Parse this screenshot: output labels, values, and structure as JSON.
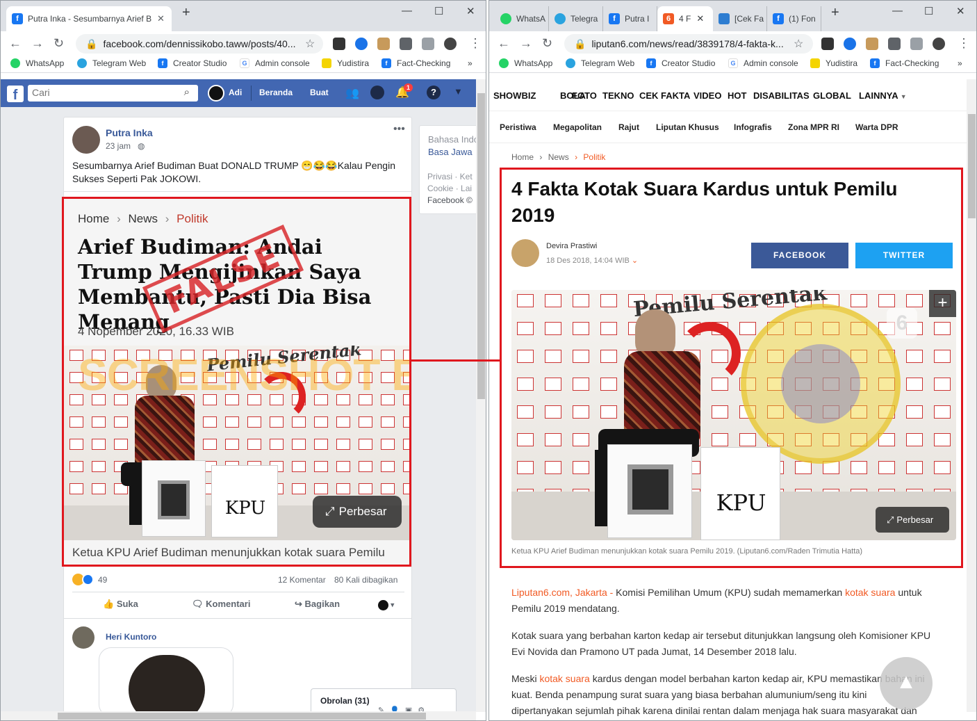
{
  "left": {
    "tab_title": "Putra Inka - Sesumbarnya Arief B",
    "url": "facebook.com/dennissikobo.taww/posts/40...",
    "bookmarks": [
      "WhatsApp",
      "Telegram Web",
      "Creator Studio",
      "Admin console",
      "Yudistira",
      "Fact-Checking"
    ],
    "fb": {
      "search_placeholder": "Cari",
      "user": "Adi",
      "nav": [
        "Beranda",
        "Buat"
      ],
      "notif_count": "1",
      "post": {
        "author": "Putra Inka",
        "time": "23 jam",
        "text_line1": "Sesumbarnya Arief Budiman Buat DONALD TRUMP 😁😂😂Kalau Pengin",
        "text_line2": "Sukses Seperti Pak JOKOWI.",
        "shared_article": {
          "breadcrumb": [
            "Home",
            "News",
            "Politik"
          ],
          "title": "Arief Budiman: Andai Trump Mengijinkan Saya Membantu, Pasti Dia Bisa Menang",
          "date": "4 Nopember 2020, 16.33 WIB",
          "stamp": "FALSE",
          "watermark": "SCREENSHOT BY",
          "enlarge": "Perbesar",
          "caption": "Ketua KPU Arief Budiman menunjukkan kotak suara Pemilu"
        },
        "reaction_count": "49",
        "comments": "12 Komentar",
        "shares": "80 Kali dibagikan",
        "actions": [
          "Suka",
          "Komentari",
          "Bagikan"
        ],
        "commenter": "Heri Kuntoro"
      },
      "side": {
        "lang1": "Bahasa Indo",
        "lang2": "Basa Jawa",
        "foot1": "Privasi · Ket",
        "foot2": "Cookie · Lai",
        "foot3": "Facebook ©"
      },
      "chat": "Obrolan (31)"
    }
  },
  "right": {
    "tabs": [
      "WhatsA",
      "Telegra",
      "Putra I",
      "4 F",
      "[Cek Fa",
      "(1) Fon"
    ],
    "url": "liputan6.com/news/read/3839178/4-fakta-k...",
    "bookmarks": [
      "WhatsApp",
      "Telegram Web",
      "Creator Studio",
      "Admin console",
      "Yudistira",
      "Fact-Checking"
    ],
    "nav1": [
      "SHOWBIZ",
      "BOLA",
      "FOTO",
      "TEKNO",
      "CEK FAKTA",
      "VIDEO",
      "HOT",
      "DISABILITAS",
      "GLOBAL",
      "LAINNYA"
    ],
    "nav2": [
      "Peristiwa",
      "Megapolitan",
      "Rajut",
      "Liputan Khusus",
      "Infografis",
      "Zona MPR RI",
      "Warta DPR"
    ],
    "breadcrumb": [
      "Home",
      "News",
      "Politik"
    ],
    "title_line1": "4 Fakta Kotak Suara Kardus untuk Pemilu",
    "title_line2": "2019",
    "author": "Devira Prastiwi",
    "date": "18 Des 2018, 14:04 WIB",
    "share_fb": "FACEBOOK",
    "share_tw": "TWITTER",
    "enlarge": "Perbesar",
    "caption": "Ketua KPU Arief Budiman menunjukkan kotak suara Pemilu 2019. (Liputan6.com/Raden Trimutia Hatta)",
    "p1_source": "Liputan6.com, Jakarta -",
    "p1_a": " Komisi Pemilihan Umum (KPU) sudah memamerkan ",
    "p1_link": "kotak suara",
    "p1_b": " untuk",
    "p1_line2": "Pemilu 2019 mendatang.",
    "p2_line1": "Kotak suara yang berbahan karton kedap air tersebut ditunjukkan langsung oleh Komisioner KPU",
    "p2_line2": "Evi Novida dan Pramono UT pada Jumat, 14 Desember 2018 lalu.",
    "p3_a": "Meski ",
    "p3_link": "kotak suara",
    "p3_b": " kardus dengan model berbahan karton kedap air, KPU memastikan bahan ini",
    "p3_line2": "kuat. Benda penampung surat suara yang biasa berbahan alumunium/seng itu kini",
    "p3_line3": "dipertanyakan sejumlah pihak karena dinilai rentan dalam menjaga hak suara masyarakat dan"
  },
  "photo_text": {
    "backdrop": "Pemilu Serentak",
    "box": "KPU"
  },
  "colors": {
    "fb_blue": "#4267b2",
    "red_box": "#e0171e",
    "lip_orange": "#f15a24",
    "lip_fb": "#3b5998",
    "lip_tw": "#1da1f2"
  }
}
